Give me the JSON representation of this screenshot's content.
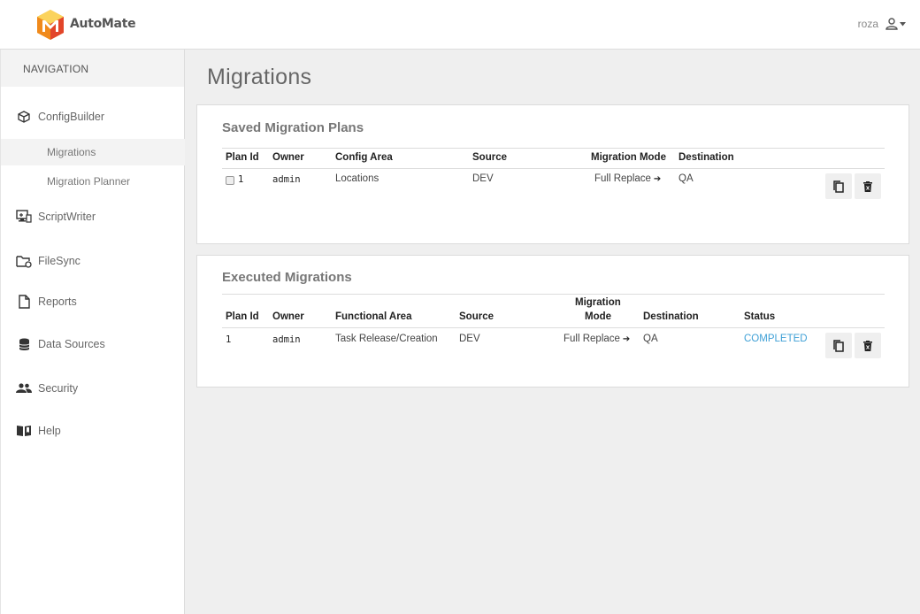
{
  "app": {
    "brand": "AutoMate",
    "user": "roza"
  },
  "navigation": {
    "heading": "NAVIGATION",
    "items": [
      {
        "label": "ConfigBuilder",
        "icon": "cube-icon"
      },
      {
        "label": "Migrations",
        "sub": true,
        "active": true
      },
      {
        "label": "Migration Planner",
        "sub": true
      },
      {
        "label": "ScriptWriter",
        "icon": "monitor-icon"
      },
      {
        "label": "FileSync",
        "icon": "folder-sync-icon"
      },
      {
        "label": "Reports",
        "icon": "document-icon"
      },
      {
        "label": "Data Sources",
        "icon": "database-icon"
      },
      {
        "label": "Security",
        "icon": "users-icon"
      },
      {
        "label": "Help",
        "icon": "book-icon"
      }
    ]
  },
  "page": {
    "title": "Migrations"
  },
  "saved": {
    "title": "Saved Migration Plans",
    "headers": [
      "Plan Id",
      "Owner",
      "Config Area",
      "Source",
      "Migration Mode",
      "Destination"
    ],
    "rows": [
      {
        "plan_id": "1",
        "owner": "admin",
        "area": "Locations",
        "source": "DEV",
        "mode": "Full Replace",
        "destination": "QA"
      }
    ]
  },
  "executed": {
    "title": "Executed Migrations",
    "headers": [
      "Plan Id",
      "Owner",
      "Functional Area",
      "Source",
      "Migration",
      "Mode",
      "Destination",
      "Status"
    ],
    "rows": [
      {
        "plan_id": "1",
        "owner": "admin",
        "area": "Task Release/Creation",
        "source": "DEV",
        "mode": "Full Replace",
        "destination": "QA",
        "status": "COMPLETED"
      }
    ]
  },
  "colors": {
    "status_completed": "#3fa0d6",
    "logo_orange": "#f39a1e",
    "logo_red": "#e2452a"
  }
}
